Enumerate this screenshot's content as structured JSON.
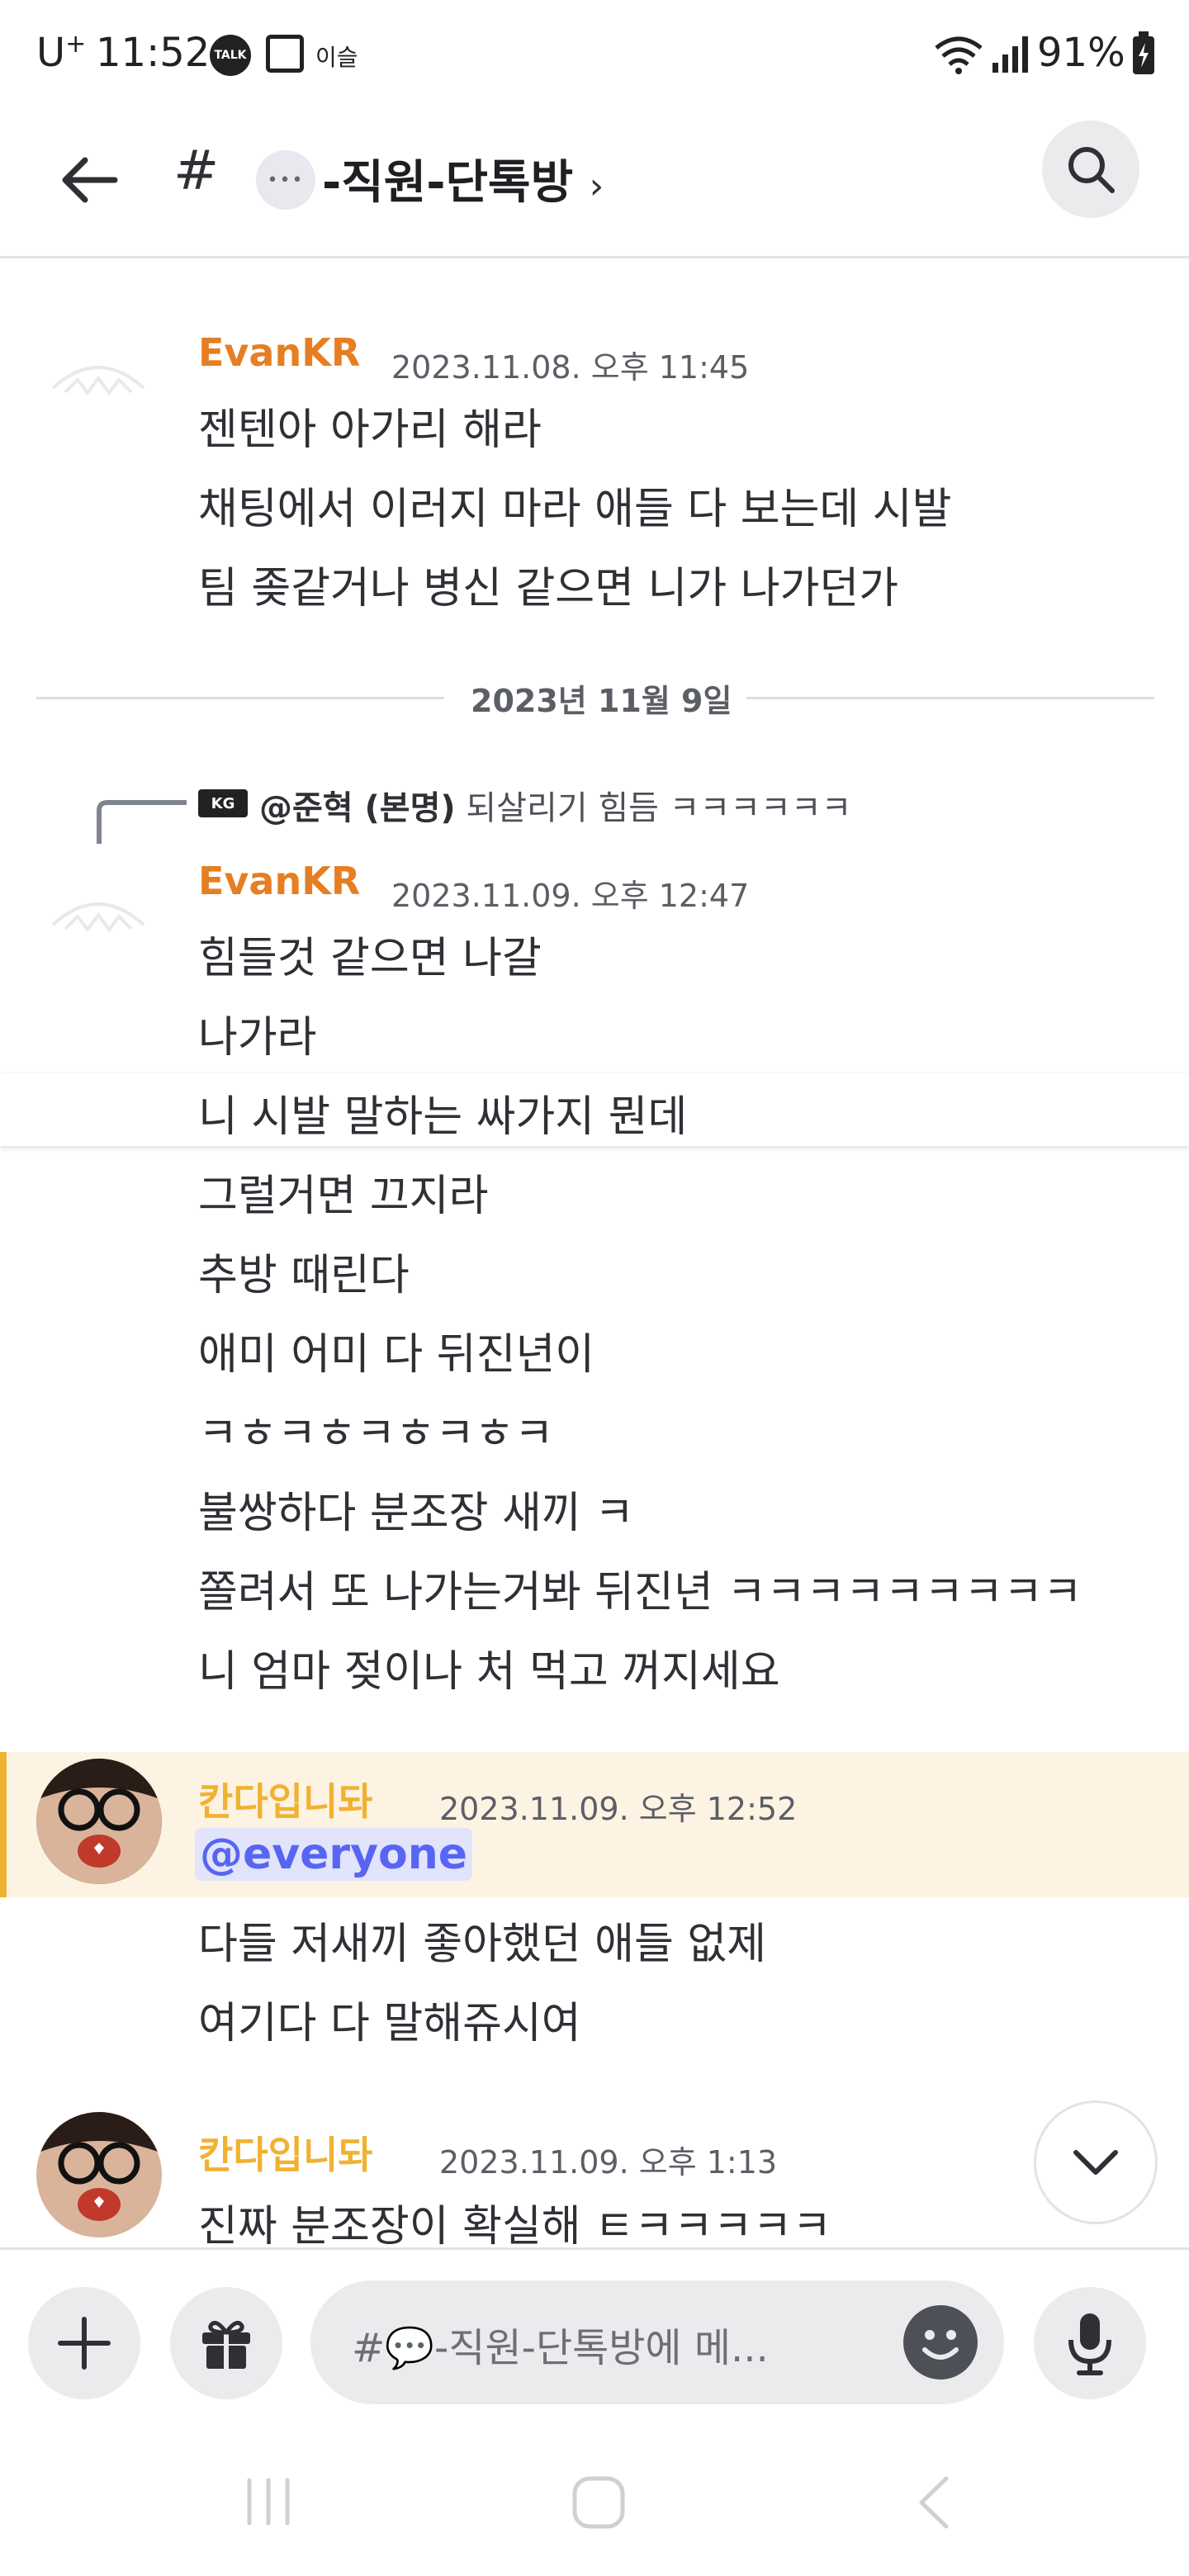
{
  "status_bar": {
    "carrier": "U",
    "carrier_sup": "+",
    "time": "11:52",
    "talk_icon_label": "TALK",
    "notif_label": "이슬",
    "battery": "91%"
  },
  "header": {
    "hash": "#",
    "channel_name": "-직원-단톡방",
    "chevron": "›"
  },
  "messages": [
    {
      "username": "EvanKR",
      "timestamp": "2023.11.08. 오후 11:45",
      "lines": [
        "젠텐아 아가리 해라",
        "채팅에서 이러지 마라 애들 다 보는데 시발",
        "팀 좆같거나 병신 같으면 니가 나가던가"
      ]
    },
    {
      "reply_prefix": "@준혁 (본명)",
      "reply_text": "되살리기 힘듬 ㅋㅋㅋㅋㅋㅋ",
      "username": "EvanKR",
      "timestamp": "2023.11.09. 오후 12:47",
      "lines": [
        "힘들것 같으면 나갈",
        "나가라",
        "니 시발 말하는 싸가지 뭔데",
        "그럴거면 끄지라",
        "추방 때린다",
        "애미 어미 다 뒤진년이",
        "ㅋㅎㅋㅎㅋㅎㅋㅎㅋ",
        "불쌍하다 분조장 새끼 ㅋ",
        "쫄려서 또 나가는거봐 뒤진년 ㅋㅋㅋㅋㅋㅋㅋㅋㅋ",
        "니 엄마 젖이나 처 먹고 꺼지세요"
      ]
    },
    {
      "username": "칸다입니돠",
      "timestamp": "2023.11.09. 오후 12:52",
      "mention": "@everyone",
      "lines": [
        "다들 저새끼 좋아했던 애들 없제",
        "여기다 다 말해쥬시여"
      ]
    },
    {
      "username": "칸다입니돠",
      "timestamp": "2023.11.09. 오후 1:13",
      "lines": [
        "진짜 분조장이 확실해 ㅌㅋㅋㅋㅋㅋ"
      ]
    }
  ],
  "date_divider": "2023년 11월 9일",
  "composer": {
    "placeholder": "#💬-직원-단톡방에 메..."
  },
  "colors": {
    "evan": "#e67e22",
    "kanda": "#f0b232",
    "mention": "#5865f2",
    "highlight": "#fdf3e3"
  },
  "icons": [
    "back-arrow-icon",
    "search-icon",
    "plus-icon",
    "gift-icon",
    "emoji-icon",
    "microphone-icon",
    "chevron-down-icon"
  ]
}
